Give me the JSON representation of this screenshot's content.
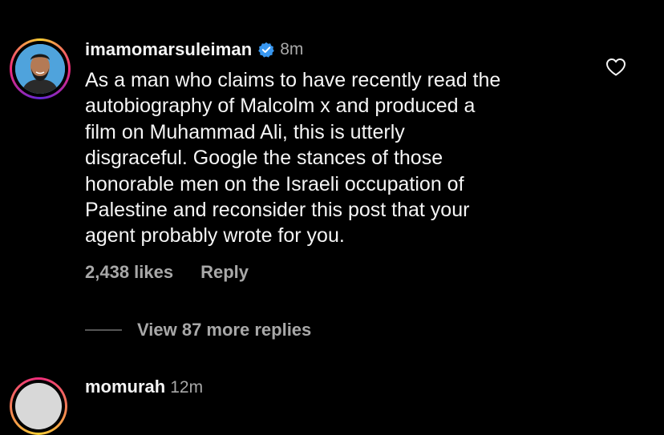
{
  "comment": {
    "username": "imamomarsuleiman",
    "verified": true,
    "time": "8m",
    "lines": [
      "As a man who claims to have recently read the",
      "autobiography of Malcolm x and produced a",
      "film on Muhammad Ali, this is utterly",
      "disgraceful. Google the stances of those",
      "honorable men on the Israeli occupation of",
      "Palestine and reconsider this post that your",
      "agent probably wrote for you."
    ],
    "likes": "2,438 likes",
    "reply_label": "Reply",
    "view_replies": "View 87 more replies",
    "heart_icon": "heart-outline-icon"
  },
  "next_comment": {
    "username": "momurah",
    "time": "12m"
  },
  "colors": {
    "background": "#000000",
    "primary_text": "#f5f5f5",
    "secondary_text": "#a8a8a8",
    "verified_badge": "#3897f0"
  }
}
